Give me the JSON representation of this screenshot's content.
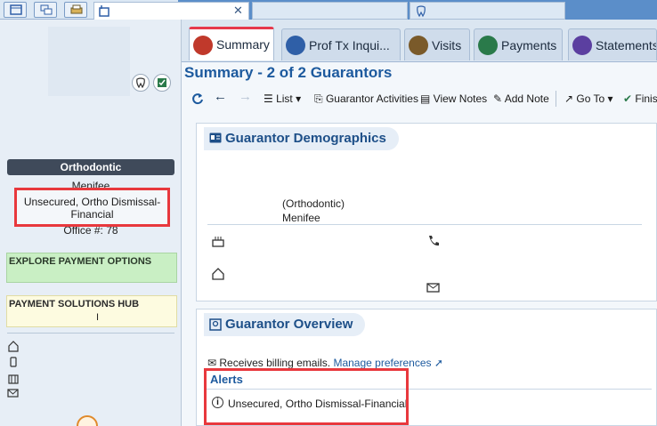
{
  "main_tabs": [
    {
      "label": "Summary",
      "icon": "summary-icon",
      "active": true,
      "color": "#c0392b"
    },
    {
      "label": "Prof Tx Inqui...",
      "icon": "inquiry-icon",
      "active": false,
      "color": "#2f5fa7"
    },
    {
      "label": "Visits",
      "icon": "visits-icon",
      "active": false,
      "color": "#7a5a2a"
    },
    {
      "label": "Payments",
      "icon": "payments-icon",
      "active": false,
      "color": "#2a7a4a"
    },
    {
      "label": "Statements",
      "icon": "statements-icon",
      "active": false,
      "color": "#5b3fa0"
    }
  ],
  "page_title": "Summary - 2 of 2 Guarantors",
  "toolbar": {
    "list": "List",
    "guarantor_activities": "Guarantor Activities",
    "view_notes": "View Notes",
    "add_note": "Add Note",
    "go_to": "Go To",
    "finish": "Finis"
  },
  "left_panel": {
    "department": "Orthodontic",
    "location_top": "Menifee",
    "status_text": "Unsecured, Ortho Dismissal-Financial",
    "office": "Office #: 78",
    "explore_payment": "EXPLORE PAYMENT OPTIONS",
    "payment_hub": "PAYMENT SOLUTIONS HUB",
    "payment_hub_cursor": "I"
  },
  "demographics": {
    "header": "Guarantor Demographics",
    "department": "(Orthodontic)",
    "location": "Menifee"
  },
  "overview": {
    "header": "Guarantor Overview",
    "billing_text": "Receives billing emails.",
    "manage_link": "Manage preferences",
    "alerts_title": "Alerts",
    "alert_text": "Unsecured, Ortho Dismissal-Financial"
  },
  "colors": {
    "accent": "#1d5a9e",
    "highlight_red": "#e8383d",
    "explore_green": "#c9efc4",
    "hub_yellow": "#fdfbe0"
  }
}
